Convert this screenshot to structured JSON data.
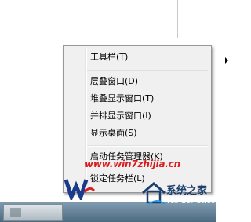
{
  "context_menu": {
    "items": [
      {
        "label": "工具栏(T)",
        "has_submenu": true
      },
      {
        "label": "层叠窗口(D)"
      },
      {
        "label": "堆叠显示窗口(T)"
      },
      {
        "label": "并排显示窗口(I)"
      },
      {
        "label": "显示桌面(S)"
      },
      {
        "label": "启动任务管理器(K)"
      },
      {
        "label": "锁定任务栏(L)"
      }
    ]
  },
  "watermarks": {
    "url": "www.win7zhijia.cn",
    "site_title": "系统之家",
    "site_sub": "Win10net.com"
  },
  "colors": {
    "menu_bg": "#f0f0f0",
    "watermark_red": "#d81e1e",
    "taskbar": "#5a7890"
  }
}
